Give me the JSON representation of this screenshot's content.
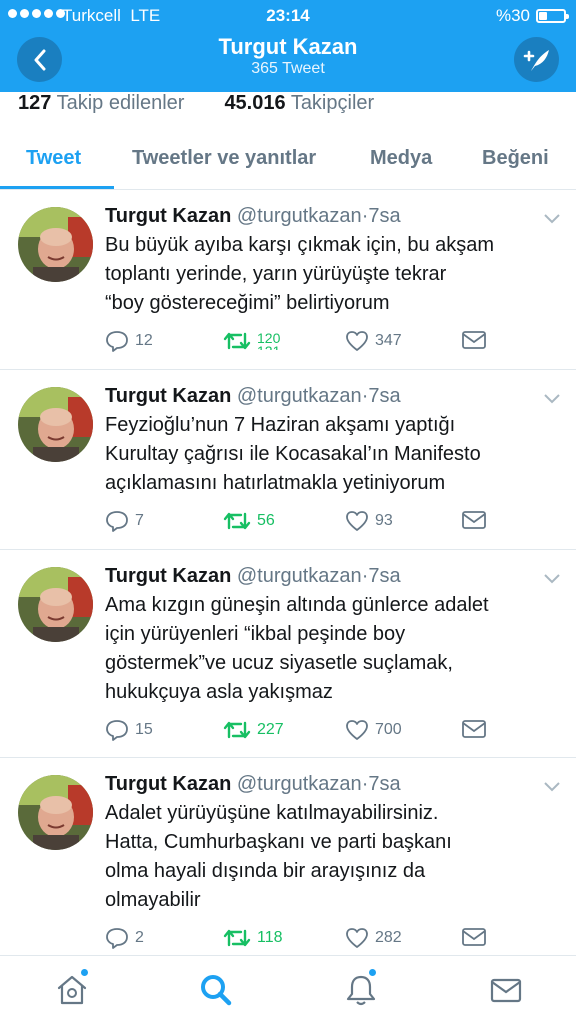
{
  "status_bar": {
    "carrier": "Turkcell",
    "network": "LTE",
    "time": "23:14",
    "battery_text": "%30",
    "battery_level": 0.3
  },
  "header": {
    "title": "Turgut Kazan",
    "subtitle": "365 Tweet",
    "back_icon": "chevron-left-icon",
    "compose_icon": "compose-tweet-icon",
    "background_color": "#1da1f2"
  },
  "profile_stats": {
    "following_count": "127",
    "following_label": "Takip edilenler",
    "followers_count": "45.016",
    "followers_label": "Takipçiler"
  },
  "tabs": [
    {
      "label": "Tweet",
      "active": true
    },
    {
      "label": "Tweetler ve yanıtlar",
      "active": false
    },
    {
      "label": "Medya",
      "active": false
    },
    {
      "label": "Beğeni",
      "active": false
    }
  ],
  "tweets": [
    {
      "name": "Turgut Kazan",
      "handle": "@turgutkazan",
      "time": "·7sa",
      "text": "Bu büyük ayıba karşı çıkmak için, bu akşam\ntoplantı yerinde, yarın yürüyüşte tekrar\n“boy göstereceğimi” belirtiyorum",
      "replies": "12",
      "retweets": "120",
      "retweets_next": "121",
      "likes": "347"
    },
    {
      "name": "Turgut Kazan",
      "handle": "@turgutkazan",
      "time": "·7sa",
      "text": "Feyzioğlu’nun 7 Haziran akşamı yaptığı\nKurultay çağrısı ile Kocasakal’ın Manifesto\naçıklamasını hatırlatmakla yetiniyorum",
      "replies": "7",
      "retweets": "56",
      "likes": "93"
    },
    {
      "name": "Turgut Kazan",
      "handle": "@turgutkazan",
      "time": "·7sa",
      "text": "Ama kızgın güneşin altında günlerce adalet\niçin yürüyenleri “ikbal peşinde boy\ngöstermek”ve ucuz siyasetle suçlamak,\nhukukçuya asla yakışmaz",
      "replies": "15",
      "retweets": "227",
      "likes": "700"
    },
    {
      "name": "Turgut Kazan",
      "handle": "@turgutkazan",
      "time": "·7sa",
      "text": "Adalet yürüyüşüne katılmayabilirsiniz.\nHatta, Cumhurbaşkanı ve parti başkanı\nolma hayali dışında bir arayışınız da\nolmayabilir",
      "replies": "2",
      "retweets": "118",
      "likes": "282"
    }
  ],
  "bottom_nav": [
    {
      "icon": "home-icon",
      "badge": true,
      "active": false
    },
    {
      "icon": "search-icon",
      "badge": false,
      "active": true
    },
    {
      "icon": "notifications-icon",
      "badge": true,
      "active": false
    },
    {
      "icon": "messages-icon",
      "badge": false,
      "active": false
    }
  ],
  "colors": {
    "accent": "#1da1f2",
    "retweet_green": "#17bf63",
    "muted": "#657786"
  }
}
